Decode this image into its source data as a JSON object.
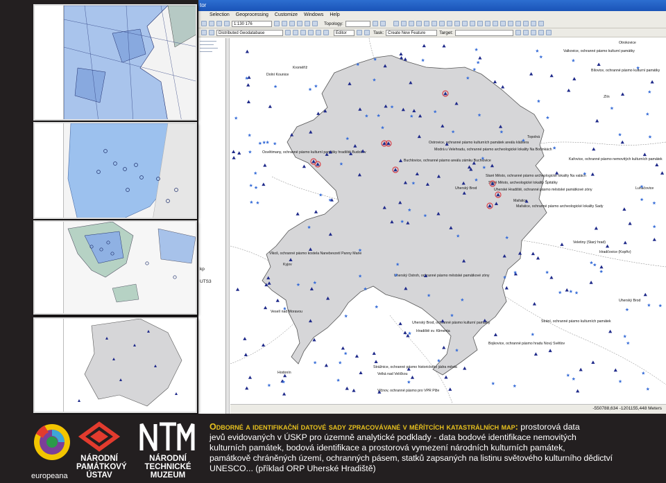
{
  "window": {
    "title_fragment": "tor"
  },
  "menu": {
    "items": [
      "Selection",
      "Geoprocessing",
      "Customize",
      "Windows",
      "Help"
    ]
  },
  "toolbar1": {
    "scale": "1:130 176",
    "topology_label": "Topology:"
  },
  "toolbar2": {
    "geodatabase": "Distributed Geodatabase",
    "editor": "Editor",
    "task_label": "Task:",
    "task_value": "Create New Feature",
    "target_label": "Target:"
  },
  "left_panel": {
    "labels": [
      "kp",
      "UTS3"
    ]
  },
  "status": {
    "coordinates": "-550788,634  -1201155,448 Meters"
  },
  "map": {
    "colors": {
      "region_fill": "#d6d6d8",
      "region_stroke": "#555555",
      "triangle": "#1f2a8a",
      "star": "#3a6fd8",
      "highlight": "#d8444c",
      "road": "#7a7a7a"
    },
    "labels": [
      "Otrokovice",
      "Valkovice, ochranné pásmo kulturní památky",
      "Kroměříž",
      "Dolní Kounice",
      "Bílovice, ochranné pásmo kulturní památky",
      "Zlín",
      "Topolná",
      "Ostrovice, ochranné pásmo kulturních památek areálu kláštera",
      "Modrá u Velehradu, ochranné pásmo archeologické lokality Na Bočinkách",
      "Osvětimany, ochranné pásmo kulturní památky hradiště Budošov",
      "Buchlovice, ochranné pásmo areálu zámku Buchlovice",
      "Staré Město, ochranné pásmo archeologické lokality Na valách",
      "Staré Město, archeologické lokality Špitálky",
      "Uherské Hradiště, ochranné pásmo městské památkové zóny",
      "Mařatice",
      "Mařatice, ochranné pásmo archeologické lokality Sady",
      "Uherský Brod",
      "Kařovice, ochranné pásmo nemovitých kulturních památek",
      "Luhačovice",
      "Veletiny (Starý hrad)",
      "Hradčovice (Kopřiv)",
      "Vlkoš, ochranné pásmo kostela Nanebevzetí Panny Marie",
      "Kyjov",
      "Uherský Ostroh, ochranné pásmo městské památkové zóny",
      "Uherský Brod, ochranné pásmo kulturní památky",
      "Veselí nad Moravou",
      "Strání, ochranné pásmo kulturních památek",
      "Hradiště sv. Klimenta",
      "Bojkovice, ochranné pásmo hradu Nový Světlov",
      "Hodonín",
      "Strážnice, ochranné pásmo historického jádra města",
      "Velká nad Veličkou",
      "Vlčnov, ochranné pásmo pro VPR Plže",
      "Uherský Brod"
    ]
  },
  "footer": {
    "heading": "Odborné a identifikační datové sady zpracovávané v měřítcích katastrálních map:",
    "line1_rest": " prostorová data",
    "line2": "jevů evidovaných v ÚSKP pro územně analytické podklady - data bodové identifikace nemovitých",
    "line3": "kulturních památek, bodová identifikace a prostorová vymezení národních kulturních památek,",
    "line4": "památkově chráněných území, ochranných pásem, statků zapsaných na listinu světového kulturního dědictví",
    "line5": "UNESCO... (příklad ORP Uherské Hradiště)",
    "logo1_label": "europeana",
    "logo2_label": [
      "NÁRODNÍ",
      "PAMÁTKOVÝ",
      "ÚSTAV"
    ],
    "logo3_label": [
      "NÁRODNÍ",
      "TECHNICKÉ",
      "MUZEUM"
    ],
    "logo_colors": {
      "npu_red": "#e23b2e",
      "europeana_yellow": "#f2c500",
      "europeana_purple": "#7b3f98"
    }
  }
}
